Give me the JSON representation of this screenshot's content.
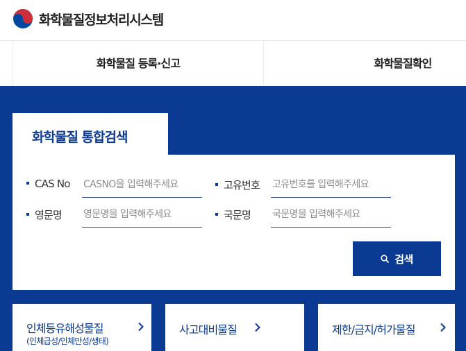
{
  "header": {
    "site_title": "화학물질정보처리시스템",
    "logo_icon": "taegeuk-logo-icon",
    "colors": {
      "red": "#cd2e3a",
      "blue": "#0047a0"
    }
  },
  "nav": {
    "items": [
      {
        "label": "화학물질 등록·신고"
      },
      {
        "label": "화학물질확인"
      }
    ]
  },
  "search": {
    "tab_label": "화학물질 통합검색",
    "fields": [
      {
        "label": "CAS No",
        "placeholder": "CASNO을 입력해주세요",
        "value": ""
      },
      {
        "label": "고유번호",
        "placeholder": "고유번호를 입력해주세요",
        "value": ""
      },
      {
        "label": "영문명",
        "placeholder": "영문명을 입력해주세요",
        "value": ""
      },
      {
        "label": "국문명",
        "placeholder": "국문명을 입력해주세요",
        "value": ""
      }
    ],
    "button_label": "검색",
    "button_icon": "search-icon"
  },
  "cards": [
    {
      "title": "인체등유해성물질",
      "subtitle": "(인체급성/인체만성/생태)",
      "icon": "chevron-right-icon"
    },
    {
      "title": "사고대비물질",
      "icon": "chevron-right-icon"
    },
    {
      "title": "제한/금지/허가물질",
      "icon": "chevron-right-icon"
    }
  ],
  "colors": {
    "primary": "#0b3a93",
    "text": "#222222",
    "placeholder": "#8e8e8e"
  }
}
